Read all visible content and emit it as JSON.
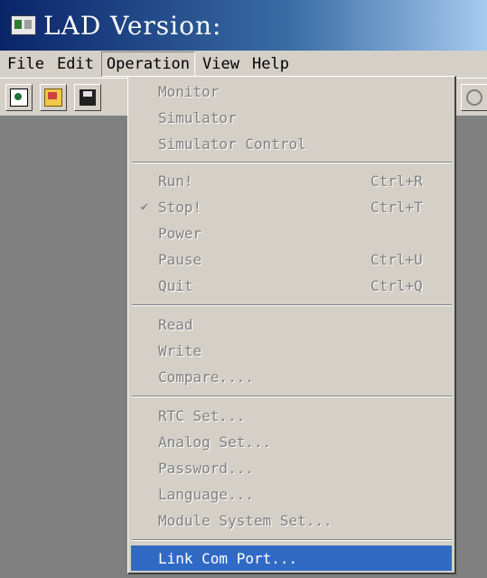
{
  "window": {
    "title": "LAD Version:"
  },
  "menubar": [
    "File",
    "Edit",
    "Operation",
    "View",
    "Help"
  ],
  "toolbar": {
    "icons": [
      "new-file-icon",
      "open-folder-icon",
      "save-disk-icon",
      "status-icon"
    ]
  },
  "dropdown": {
    "items": [
      {
        "label": "Monitor",
        "shortcut": "",
        "checked": false,
        "enabled": false
      },
      {
        "label": "Simulator",
        "shortcut": "",
        "checked": false,
        "enabled": false
      },
      {
        "label": "Simulator Control",
        "shortcut": "",
        "checked": false,
        "enabled": false
      },
      {
        "label": "Run!",
        "shortcut": "Ctrl+R",
        "checked": false,
        "enabled": false
      },
      {
        "label": "Stop!",
        "shortcut": "Ctrl+T",
        "checked": true,
        "enabled": false
      },
      {
        "label": "Power",
        "shortcut": "",
        "checked": false,
        "enabled": false
      },
      {
        "label": "Pause",
        "shortcut": "Ctrl+U",
        "checked": false,
        "enabled": false
      },
      {
        "label": "Quit",
        "shortcut": "Ctrl+Q",
        "checked": false,
        "enabled": false
      },
      {
        "label": "Read",
        "shortcut": "",
        "checked": false,
        "enabled": false
      },
      {
        "label": "Write",
        "shortcut": "",
        "checked": false,
        "enabled": false
      },
      {
        "label": "Compare....",
        "shortcut": "",
        "checked": false,
        "enabled": false
      },
      {
        "label": "RTC Set...",
        "shortcut": "",
        "checked": false,
        "enabled": false
      },
      {
        "label": "Analog Set...",
        "shortcut": "",
        "checked": false,
        "enabled": false
      },
      {
        "label": "Password...",
        "shortcut": "",
        "checked": false,
        "enabled": false
      },
      {
        "label": "Language...",
        "shortcut": "",
        "checked": false,
        "enabled": false
      },
      {
        "label": "Module System Set...",
        "shortcut": "",
        "checked": false,
        "enabled": false
      },
      {
        "label": "Link Com Port...",
        "shortcut": "",
        "checked": false,
        "enabled": true,
        "selected": true
      }
    ],
    "check_glyph": "✔"
  },
  "colors": {
    "selection": "#316ac5",
    "titlebar": "#0a246a",
    "face": "#d4d0c8"
  }
}
